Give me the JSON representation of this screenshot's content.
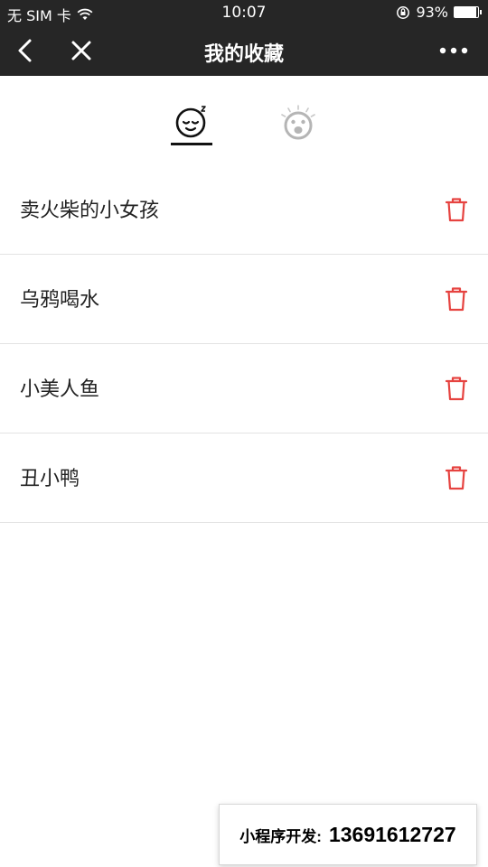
{
  "status_bar": {
    "carrier": "无 SIM 卡",
    "time": "10:07",
    "battery_percent": "93%",
    "battery_level": 0.93
  },
  "nav": {
    "title": "我的收藏",
    "back_icon": "chevron-left-icon",
    "close_icon": "close-icon",
    "more_icon": "more-dots-icon"
  },
  "tabs": [
    {
      "icon": "sleepy-face-icon",
      "active": true
    },
    {
      "icon": "surprised-face-icon",
      "active": false
    }
  ],
  "favorites": [
    {
      "title": "卖火柴的小女孩",
      "action_icon": "trash-icon"
    },
    {
      "title": "乌鸦喝水",
      "action_icon": "trash-icon"
    },
    {
      "title": "小美人鱼",
      "action_icon": "trash-icon"
    },
    {
      "title": "丑小鸭",
      "action_icon": "trash-icon"
    }
  ],
  "watermark": {
    "label": "小程序开发:",
    "phone": "13691612727"
  },
  "colors": {
    "nav_bg": "#262626",
    "delete_red": "#e64340",
    "inactive_icon": "#b5b5b5"
  }
}
